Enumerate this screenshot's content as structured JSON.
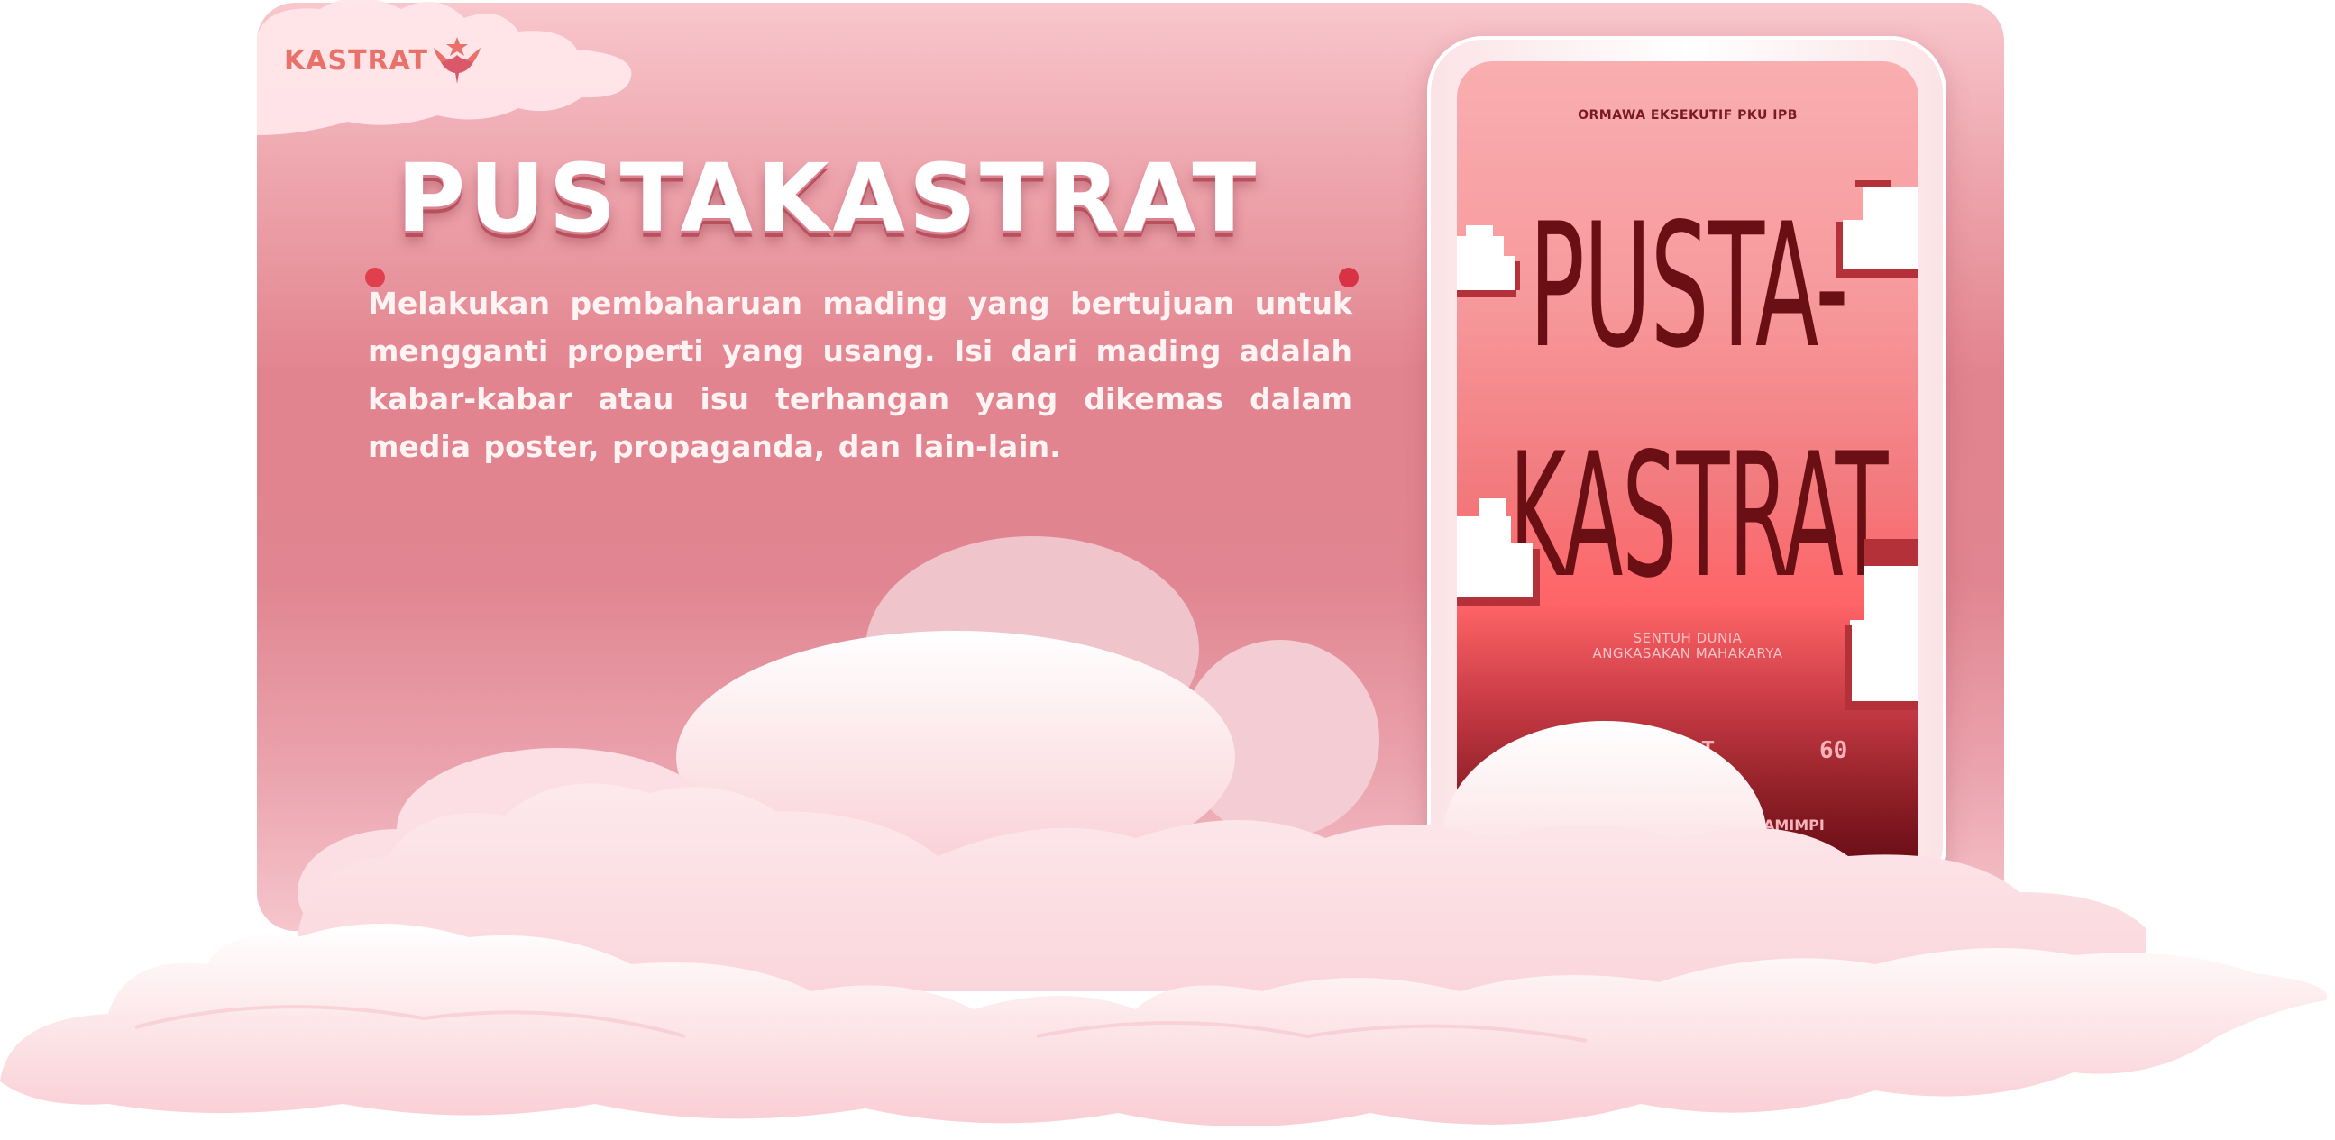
{
  "brand": {
    "name": "KASTRAT",
    "logo_icon": "phoenix-icon"
  },
  "section": {
    "title": "PUSTAKASTRAT",
    "description": "Melakukan pembaharuan mading yang bertujuan untuk mengganti properti yang usang. Isi dari mading adalah kabar-kabar atau isu terhangan yang dikemas dalam media poster, propaganda, dan lain-lain."
  },
  "poster": {
    "org": "ORMAWA EKSEKUTIF PKU IPB",
    "title_line1": "PUSTA-",
    "title_line2": "KASTRAT",
    "slogan_line1": "SENTUH DUNIA",
    "slogan_line2": "ANGKASAKAN MAHAKARYA",
    "fragment_left": "AT",
    "fragment_number": "60",
    "fragment_bottom": "AMIMPI"
  },
  "colors": {
    "card_top": "#f8c7cc",
    "card_mid": "#e2848f",
    "accent_red": "#e0404e",
    "poster_text": "#6a0f14",
    "brand_text": "#e8716a"
  }
}
